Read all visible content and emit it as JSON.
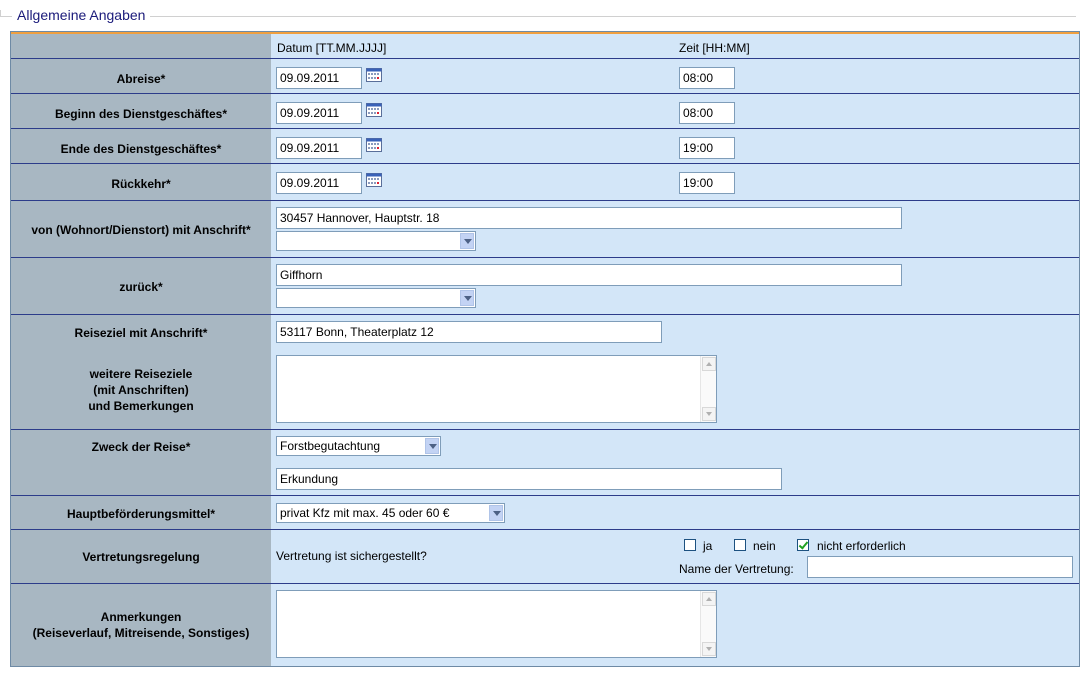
{
  "section": {
    "legend": "Allgemeine Angaben"
  },
  "colors": {
    "left_column": "#a8b7c2",
    "right_area": "#d3e6f8",
    "accent": "#f0a040",
    "legend_text": "#1a1a7a"
  },
  "header": {
    "date_label": "Datum [TT.MM.JJJJ]",
    "time_label": "Zeit [HH:MM]"
  },
  "rows": {
    "abreise": {
      "label": "Abreise*",
      "date": "09.09.2011",
      "time": "08:00"
    },
    "beginn": {
      "label": "Beginn des Dienstgeschäftes*",
      "date": "09.09.2011",
      "time": "08:00"
    },
    "ende": {
      "label": "Ende des Dienstgeschäftes*",
      "date": "09.09.2011",
      "time": "19:00"
    },
    "rueckkehr": {
      "label": "Rückkehr*",
      "date": "09.09.2011",
      "time": "19:00"
    }
  },
  "von": {
    "label": "von (Wohnort/Dienstort) mit Anschrift*",
    "value": "30457 Hannover, Hauptstr. 18",
    "select_value": ""
  },
  "zurueck": {
    "label": "zurück*",
    "value": "Giffhorn",
    "select_value": ""
  },
  "reiseziel": {
    "label": "Reiseziel mit Anschrift*",
    "value": "53117 Bonn, Theaterplatz 12"
  },
  "weitere": {
    "label_line1": "weitere Reiseziele",
    "label_line2": "(mit Anschriften)",
    "label_line3": "und Bemerkungen",
    "value": ""
  },
  "zweck": {
    "label": "Zweck der Reise*",
    "select_value": "Forstbegutachtung",
    "text_value": "Erkundung"
  },
  "befoerderung": {
    "label": "Hauptbeförderungsmittel*",
    "select_value": "privat Kfz mit max. 45 oder 60 €"
  },
  "vertretung": {
    "label": "Vertretungsregelung",
    "question": "Vertretung ist sichergestellt?",
    "options": [
      {
        "label": "ja",
        "checked": false
      },
      {
        "label": "nein",
        "checked": false
      },
      {
        "label": "nicht erforderlich",
        "checked": true
      }
    ],
    "name_label": "Name der Vertretung:",
    "name_value": ""
  },
  "anmerkungen": {
    "label_line1": "Anmerkungen",
    "label_line2": "(Reiseverlauf, Mitreisende, Sonstiges)",
    "value": ""
  },
  "icons": {
    "calendar": "calendar-icon",
    "dropdown": "chevron-down-icon",
    "check": "check-icon"
  }
}
